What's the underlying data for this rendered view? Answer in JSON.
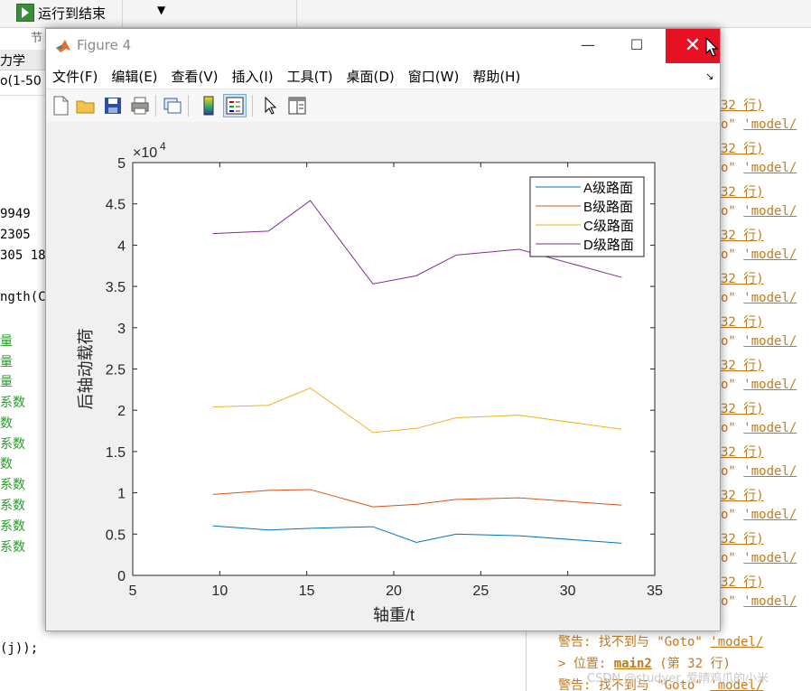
{
  "toolstrip": {
    "run_to_end_label": "运行到结束",
    "section_label": "节"
  },
  "editor": {
    "tab_label": "力学",
    "path_label": "o(1-50",
    "code_lines": [
      "9949",
      "2305",
      "305 18",
      "ngth(C",
      "(j));"
    ],
    "comment_lines": [
      "量",
      "量",
      "量",
      "系数",
      "数",
      "系数",
      "数",
      "系数",
      "系数",
      "系数",
      "系数"
    ]
  },
  "command_window": {
    "warning_prefix": "警告: 找不到与",
    "goto_text": "\"Goto\"",
    "model_link": "'model/",
    "position_prefix": "> 位置: ",
    "main2": "main2",
    "line_info": "(第 32 行)",
    "line_frag": "32 行)",
    "o_frag": "o\"",
    "watermark": "CSDN @studyer_爱晴鸡爪的小米"
  },
  "figure": {
    "title": "Figure 4",
    "menus": [
      "文件(F)",
      "编辑(E)",
      "查看(V)",
      "插入(I)",
      "工具(T)",
      "桌面(D)",
      "窗口(W)",
      "帮助(H)"
    ],
    "toolbar_icons": [
      "new-figure-icon",
      "open-icon",
      "save-icon",
      "print-icon",
      "link-plot-icon",
      "colorbar-icon",
      "legend-icon",
      "pointer-icon",
      "property-editor-icon"
    ]
  },
  "chart_data": {
    "type": "line",
    "xlabel": "轴重/t",
    "ylabel": "后轴动载荷",
    "exponent_label": "×10",
    "exponent_power": "4",
    "xlim": [
      5,
      35
    ],
    "ylim": [
      0,
      5
    ],
    "y_scale": 10000,
    "xticks": [
      5,
      10,
      15,
      20,
      25,
      30,
      35
    ],
    "yticks": [
      0,
      0.5,
      1,
      1.5,
      2,
      2.5,
      3,
      3.5,
      4,
      4.5,
      5
    ],
    "ytick_labels": [
      "0",
      "0.5",
      "1",
      "1.5",
      "2",
      "2.5",
      "3",
      "3.5",
      "4",
      "4.5",
      "5"
    ],
    "legend_position": "top-right",
    "x": [
      9.6,
      12.8,
      15.2,
      18.8,
      21.3,
      23.6,
      27.2,
      33.1
    ],
    "series": [
      {
        "name": "A级路面",
        "color": "#0072bd",
        "values": [
          6000,
          5500,
          5700,
          5900,
          4000,
          5000,
          4800,
          3900
        ]
      },
      {
        "name": "B级路面",
        "color": "#d95319",
        "values": [
          9800,
          10300,
          10400,
          8300,
          8600,
          9200,
          9400,
          8500
        ]
      },
      {
        "name": "C级路面",
        "color": "#edb120",
        "values": [
          20400,
          20600,
          22700,
          17300,
          17800,
          19100,
          19400,
          17700
        ]
      },
      {
        "name": "D级路面",
        "color": "#7e2f8e",
        "values": [
          41400,
          41700,
          45400,
          35300,
          36300,
          38800,
          39500,
          36100
        ]
      }
    ]
  }
}
